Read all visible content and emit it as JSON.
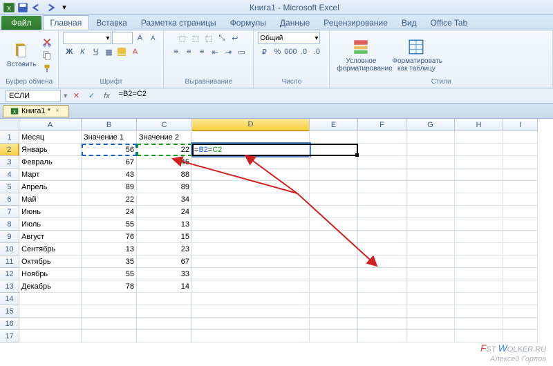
{
  "app": {
    "title": "Книга1 - Microsoft Excel"
  },
  "qat": {
    "save": "save-icon",
    "undo": "undo-icon",
    "redo": "redo-icon"
  },
  "tabs": {
    "file": "Файл",
    "items": [
      "Главная",
      "Вставка",
      "Разметка страницы",
      "Формулы",
      "Данные",
      "Рецензирование",
      "Вид",
      "Office Tab"
    ],
    "active": 0
  },
  "ribbon": {
    "clipboard": {
      "paste": "Вставить",
      "label": "Буфер обмена"
    },
    "font": {
      "family": "",
      "size": "",
      "bold": "Ж",
      "italic": "К",
      "underline": "Ч",
      "label": "Шрифт"
    },
    "align": {
      "label": "Выравнивание"
    },
    "number": {
      "format": "Общий",
      "label": "Число"
    },
    "styles": {
      "cond": "Условное форматирование",
      "table": "Форматировать как таблицу",
      "label": "Стили"
    }
  },
  "formula_bar": {
    "name_box": "ЕСЛИ",
    "formula": "=B2=C2",
    "formula_parts": {
      "eq1": "=",
      "ref1": "B2",
      "eq2": "=",
      "ref2": "C2"
    }
  },
  "workbook_tab": "Книга1 *",
  "grid": {
    "col_widths": {
      "A": 90,
      "B": 80,
      "C": 80,
      "D": 170,
      "E": 70,
      "F": 70,
      "G": 70,
      "H": 70,
      "I": 50
    },
    "columns": [
      "A",
      "B",
      "C",
      "D",
      "E",
      "F",
      "G",
      "H",
      "I"
    ],
    "selected_col": "D",
    "selected_row": 2,
    "active_cell": "D2",
    "edit_text": {
      "eq1": "=",
      "ref1": "B2",
      "eq2": "=",
      "ref2": "C2"
    },
    "headers": [
      "Месяц",
      "Значение 1",
      "Значение 2"
    ],
    "rows": [
      {
        "month": "Январь",
        "v1": 56,
        "v2": 22
      },
      {
        "month": "Февраль",
        "v1": 67,
        "v2": 45
      },
      {
        "month": "Март",
        "v1": 43,
        "v2": 88
      },
      {
        "month": "Апрель",
        "v1": 89,
        "v2": 89
      },
      {
        "month": "Май",
        "v1": 22,
        "v2": 34
      },
      {
        "month": "Июнь",
        "v1": 24,
        "v2": 24
      },
      {
        "month": "Июль",
        "v1": 55,
        "v2": 13
      },
      {
        "month": "Август",
        "v1": 76,
        "v2": 15
      },
      {
        "month": "Сентябрь",
        "v1": 13,
        "v2": 23
      },
      {
        "month": "Октябрь",
        "v1": 35,
        "v2": 67
      },
      {
        "month": "Ноябрь",
        "v1": 55,
        "v2": 33
      },
      {
        "month": "Декабрь",
        "v1": 78,
        "v2": 14
      }
    ],
    "blank_rows": [
      14,
      15,
      16,
      17
    ]
  },
  "watermark": {
    "line1_pre": "F",
    "line1_mid": "ST ",
    "line1_w": "W",
    "line1_end": "OLKER.RU",
    "line2": "Алексей Горлов"
  }
}
